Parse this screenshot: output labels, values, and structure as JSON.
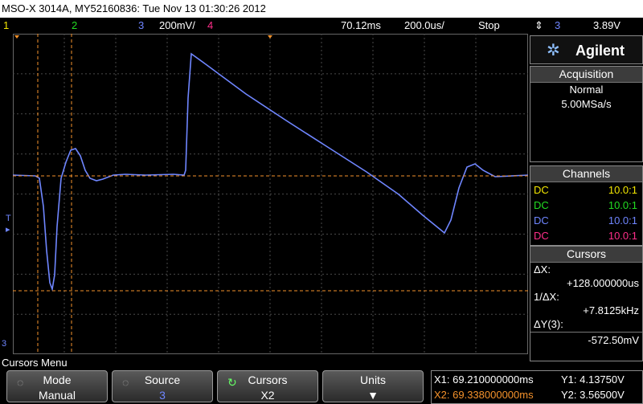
{
  "titlebar": {
    "text": "MSO-X 3014A, MY52160836: Tue Nov 13 01:30:26 2012"
  },
  "status": {
    "ch1": "1",
    "ch2": "2",
    "ch3": "3",
    "ch3_scale": "200mV/",
    "ch4": "4",
    "time_pos": "70.12ms",
    "time_scale": "200.0us/",
    "run_state": "Stop",
    "trigger_source": "3",
    "trigger_level": "3.89V"
  },
  "colors": {
    "ch1": "#f2e600",
    "ch2": "#22dd22",
    "ch3": "#6f86ff",
    "ch4": "#ff2f8a",
    "cursor": "#f5922b"
  },
  "brand": {
    "name": "Agilent"
  },
  "acquisition": {
    "header": "Acquisition",
    "mode": "Normal",
    "rate": "5.00MSa/s"
  },
  "channels": {
    "header": "Channels",
    "rows": [
      {
        "coupling": "DC",
        "probe": "10.0:1"
      },
      {
        "coupling": "DC",
        "probe": "10.0:1"
      },
      {
        "coupling": "DC",
        "probe": "10.0:1"
      },
      {
        "coupling": "DC",
        "probe": "10.0:1"
      }
    ]
  },
  "cursors": {
    "header": "Cursors",
    "dx_label": "ΔX:",
    "dx_value": "+128.000000us",
    "inv_dx_label": "1/ΔX:",
    "inv_dx_value": "+7.8125kHz",
    "dy_label": "ΔY(3):",
    "dy_value": "-572.50mV"
  },
  "menu": {
    "title": "Cursors Menu",
    "softkeys": [
      {
        "top": "Mode",
        "bottom": "Manual"
      },
      {
        "top": "Source",
        "bottom": "3"
      },
      {
        "top": "Cursors",
        "bottom": "X2"
      },
      {
        "top": "Units",
        "bottom": ""
      }
    ]
  },
  "readout": {
    "x1": "X1: 69.210000000ms",
    "x2": "X2: 69.338000000ms",
    "y1": "Y1: 4.13750V",
    "y2": "Y2: 3.56500V"
  },
  "screen_markers": {
    "trigger_marker": "T",
    "ch3_marker": "3"
  }
}
